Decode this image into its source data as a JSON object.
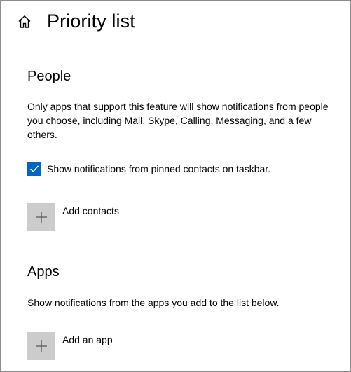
{
  "header": {
    "home_icon": "home-icon",
    "title": "Priority list"
  },
  "people": {
    "title": "People",
    "description": "Only apps that support this feature will show notifications from people you choose, including Mail, Skype, Calling, Messaging, and a few others.",
    "checkbox": {
      "label": "Show notifications from pinned contacts on taskbar.",
      "checked": true
    },
    "add_contacts": {
      "icon": "plus-icon",
      "label": "Add contacts"
    }
  },
  "apps": {
    "title": "Apps",
    "description": "Show notifications from the apps you add to the list below.",
    "add_app": {
      "icon": "plus-icon",
      "label": "Add an app"
    }
  },
  "colors": {
    "accent": "#0067c0",
    "tile": "#cccccc",
    "text": "#000000",
    "border": "#8c8c8c"
  }
}
